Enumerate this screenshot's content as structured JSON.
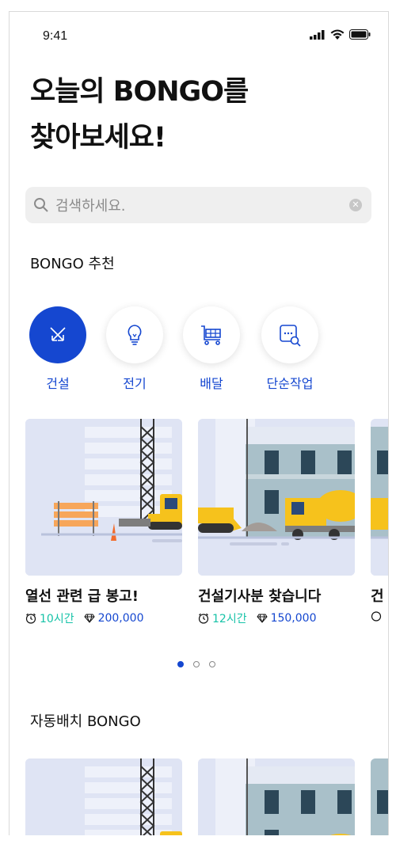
{
  "status_bar": {
    "time": "9:41"
  },
  "header": {
    "title_line1": "오늘의 BONGO를",
    "title_line2": "찾아보세요!"
  },
  "search": {
    "placeholder": "검색하세요."
  },
  "sections": {
    "recommend": "BONGO 추천",
    "auto": "자동배치 BONGO"
  },
  "categories": [
    {
      "label": "건설",
      "icon": "construction-icon",
      "active": true
    },
    {
      "label": "전기",
      "icon": "lightbulb-icon",
      "active": false
    },
    {
      "label": "배달",
      "icon": "cart-icon",
      "active": false
    },
    {
      "label": "단순작업",
      "icon": "simple-task-icon",
      "active": false
    }
  ],
  "jobs": [
    {
      "title": "열선 관련 급 봉고!",
      "time": "10시간",
      "price": "200,000"
    },
    {
      "title": "건설기사분 찾습니다",
      "time": "12시간",
      "price": "150,000"
    },
    {
      "title": "건",
      "time": "",
      "price": ""
    }
  ],
  "pagination": {
    "current": 1,
    "total": 3
  },
  "colors": {
    "primary": "#1547d0",
    "accent_green": "#17c3a8",
    "card_bg": "#dfe4f4"
  }
}
